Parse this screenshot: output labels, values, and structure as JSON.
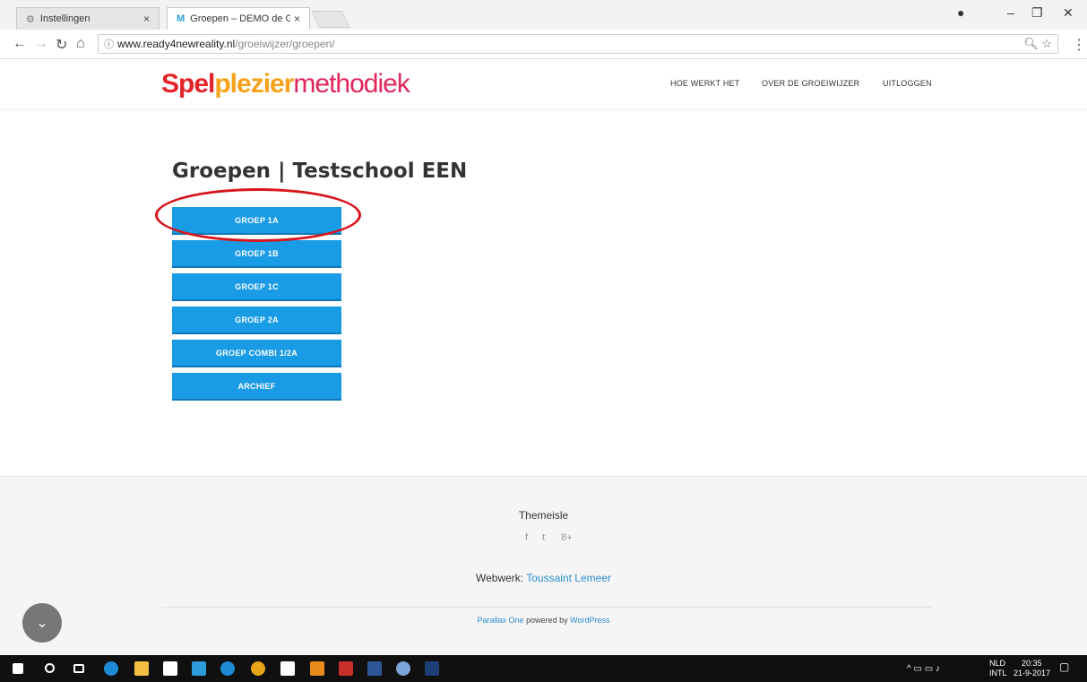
{
  "browser": {
    "tabs": [
      {
        "label": "Instellingen",
        "icon": "gear-icon"
      },
      {
        "label": "Groepen – DEMO de Gro",
        "icon": "site-favicon"
      }
    ],
    "url_host": "www.ready4newreality.nl",
    "url_path": "/groeiwijzer/groepen/"
  },
  "site": {
    "logo": {
      "part1": "Spel",
      "part2": "plezier",
      "part3": "metho",
      "part4": "diek"
    },
    "nav": [
      "HOE WERKT HET",
      "OVER DE GROEIWIJZER",
      "UITLOGGEN"
    ]
  },
  "main": {
    "title": "Groepen | Testschool EEN",
    "groups": [
      "GROEP 1A",
      "GROEP 1B",
      "GROEP 1C",
      "GROEP 2A",
      "GROEP COMBI 1/2A",
      "ARCHIEF"
    ],
    "button_color": "#1a9be6"
  },
  "footer": {
    "brand": "Themeisle",
    "social": [
      "f",
      "t",
      "8+"
    ],
    "webwerk_label": "Webwerk:",
    "webwerk_name": "Toussaint Lemeer",
    "theme_name": "Parallax One",
    "powered_text": "powered by",
    "platform": "WordPress"
  },
  "taskbar": {
    "lang1": "NLD",
    "lang2": "INTL",
    "time": "20:35",
    "date": "21-9-2017"
  }
}
